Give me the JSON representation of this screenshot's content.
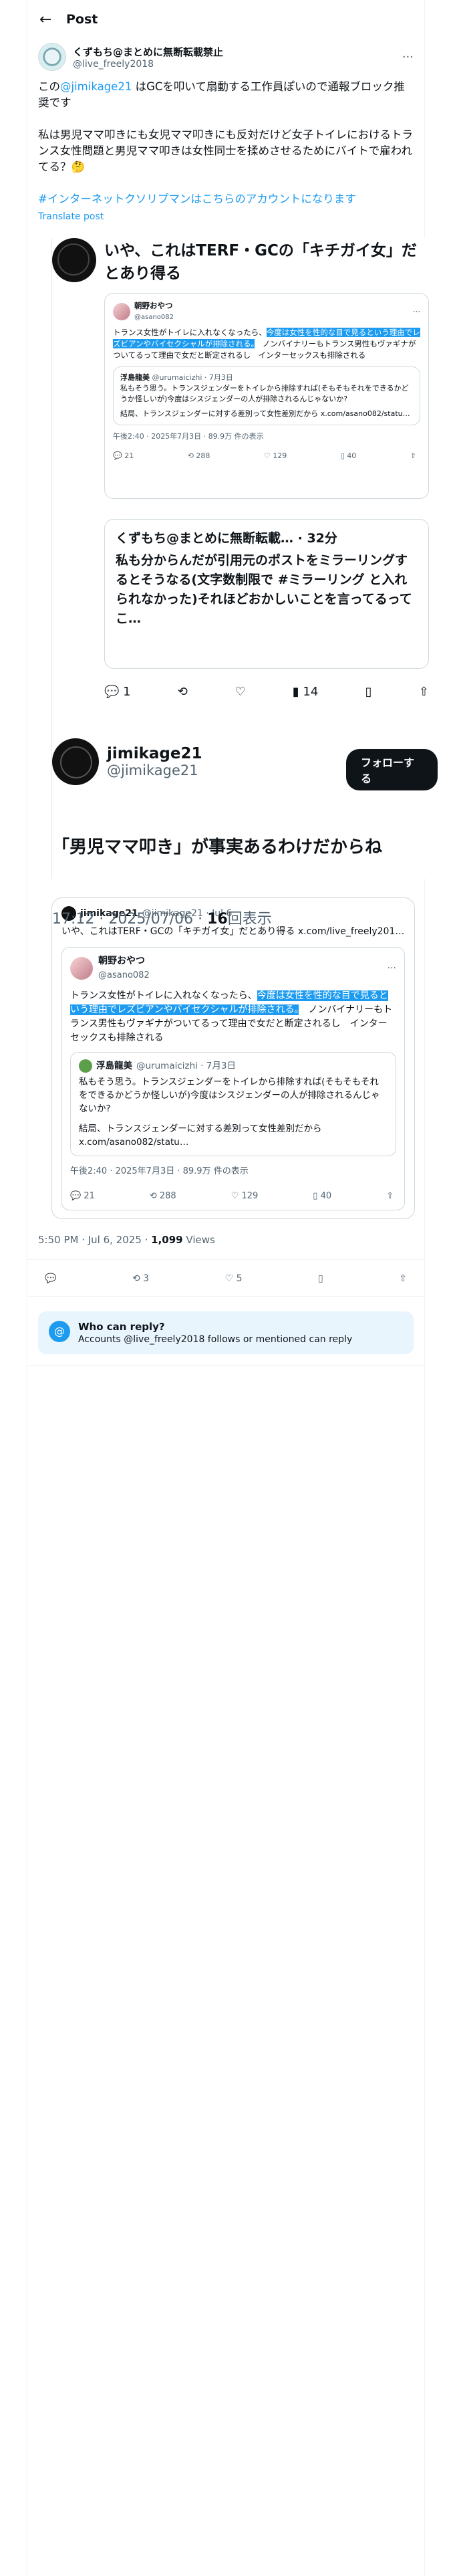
{
  "header": {
    "back_icon": "←",
    "title": "Post"
  },
  "author": {
    "name": "くずもち@まとめに無断転載禁止",
    "handle": "@live_freely2018",
    "more_icon": "···"
  },
  "post": {
    "line1_pre": "この",
    "line1_mention": "@jimikage21",
    "line1_post": " はGCを叩いて扇動する工作員ぽいので通報ブロック推奨です",
    "para2": "私は男児ママ叩きにも女児ママ叩きにも反対だけど女子トイレにおけるトランス女性問題と男児ママ叩きは女性同士を揉めさせるためにバイトで雇われてる？🤔",
    "hashtag": "#インターネットクソリプマンはこちらのアカウントになります",
    "translate": "Translate post"
  },
  "shot": {
    "text": "いや、これはTERF・GCの「キチガイ女」だとあり得る",
    "qcard": {
      "name": "朝野おやつ",
      "handle": "@asano082",
      "body_pre": "トランス女性がトイレに入れなくなったら、",
      "body_hl": "今度は女性を性的な目で見るという理由でレズビアンやバイセクシャルが排除される。",
      "body_post": "ノンバイナリーもトランス男性もヴァギナがついてるって理由で女だと断定されるし　インターセックスも排除される",
      "inner_name": "浮島龍美",
      "inner_handle": "@urumaicizhi · 7月3日",
      "inner_body": "私もそう思う。トランスジェンダーをトイレから排除すれば(そもそもそれをできるかどうか怪しいが)今度はシスジェンダーの人が排除されるんじゃないか?",
      "inner_more": "結局、トランスジェンダーに対する差別って女性差別だから x.com/asano082/statu…",
      "meta": "午後2:40 · 2025年7月3日 · 89.9万 件の表示",
      "acts": [
        "21",
        "288",
        "129",
        "40",
        ""
      ]
    },
    "rcard": {
      "name": "くずもち@まとめに無断転載… · 32分",
      "body": "私も分からんだが引用元のポストをミラーリングするとそうなる(文字数制限で #ミラーリング と入れられなかった)それほどおかしいことを言ってるってこ…"
    },
    "ract": [
      "1",
      "",
      "",
      "14",
      "",
      ""
    ],
    "jk_name": "jimikage21",
    "jk_handle": "@jimikage21",
    "follow": "フォローする",
    "jk_text": "「男児ママ叩き」が事実あるわけだからね",
    "jk_time": "17:12 · 2025/07/06 · ",
    "jk_views": "16",
    "jk_views_label": "回表示"
  },
  "quote2": {
    "name": "jimikage21",
    "handle": "@jimikage21 · Jul 6",
    "body": "いや、これはTERF・GCの「キチガイ女」だとあり得る x.com/live_freely201…",
    "inner_name": "朝野おやつ",
    "inner_handle": "@asano082",
    "inner_pre": "トランス女性がトイレに入れなくなったら、",
    "inner_hl": "今度は女性を性的な目で見るという理由でレズビアンやバイセクシャルが排除される。",
    "inner_post": "ノンバイナリーもトランス男性もヴァギナがついてるって理由で女だと断定されるし　インターセックスも排除される",
    "q3_name": "浮島龍美",
    "q3_handle": "@urumaicizhi · 7月3日",
    "q3_body": "私もそう思う。トランスジェンダーをトイレから排除すれば(そもそもそれをできるかどうか怪しいが)今度はシスジェンダーの人が排除されるんじゃないか?",
    "q3_more": "結局、トランスジェンダーに対する差別って女性差別だから x.com/asano082/statu…",
    "meta": "午後2:40 · 2025年7月3日 · 89.9万 件の表示",
    "acts": [
      "21",
      "288",
      "129",
      "40",
      ""
    ]
  },
  "timestamp": {
    "time": "5:50 PM · Jul 6, 2025 · ",
    "views": "1,099",
    "views_label": " Views"
  },
  "actions": {
    "reply": "",
    "repost": "3",
    "like": "5",
    "bookmark": "",
    "share": ""
  },
  "who_can_reply": {
    "title": "Who can reply?",
    "desc": "Accounts @live_freely2018 follows or mentioned can reply"
  }
}
